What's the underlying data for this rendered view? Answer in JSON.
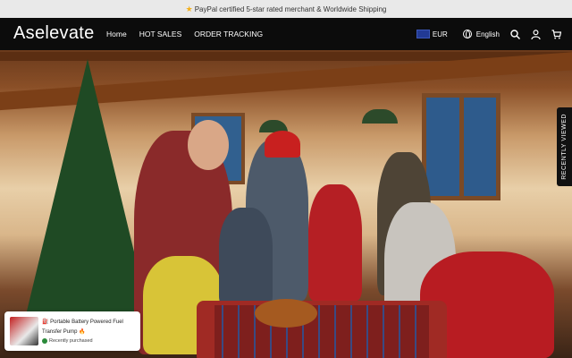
{
  "announcement": {
    "icon": "star-icon",
    "text": "PayPal certified 5-star rated merchant & Worldwide Shipping"
  },
  "header": {
    "logo": "Aselevate",
    "menu": [
      "Home",
      "HOT SALES",
      "ORDER TRACKING"
    ],
    "currency": "EUR",
    "language": "English",
    "icons": [
      "search-icon",
      "account-icon",
      "cart-icon"
    ]
  },
  "side_tab": {
    "label": "RECENTLY VIEWED"
  },
  "toast": {
    "product": "Portable Battery Powered Fuel Transfer Pump",
    "emoji_prefix": "⛽",
    "emoji_suffix": "🔥",
    "status": "Recently purchased"
  },
  "colors": {
    "nav_bg": "#0c0c0c",
    "announce_bg": "#e9e9e9",
    "accent_star": "#f2b01e"
  }
}
